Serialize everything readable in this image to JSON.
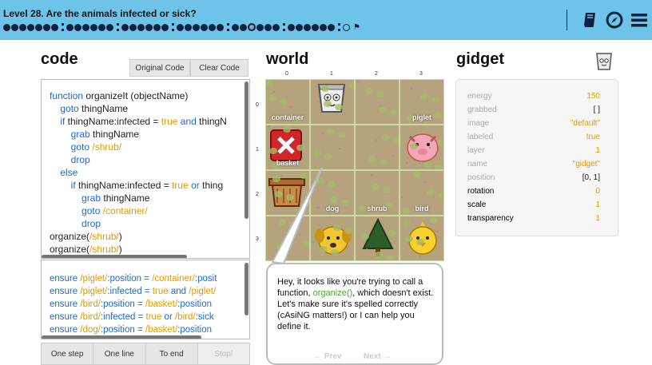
{
  "header": {
    "level_title": "Level 28. Are the animals infected or sick?",
    "progress_groups": [
      7,
      6,
      6,
      6,
      6,
      6,
      1
    ],
    "current_level_marker": "☺"
  },
  "icons": {
    "book": "book-icon",
    "compass": "compass-icon",
    "menu": "menu-icon"
  },
  "code": {
    "title": "code",
    "original_button": "Original Code",
    "clear_button": "Clear Code"
  },
  "ensure": {
    "lines": [
      {
        "a": "ensure ",
        "b": "/piglet/",
        "c": ":position = ",
        "d": "/container/",
        "e": ":posit"
      },
      {
        "a": "ensure ",
        "b": "/piglet/",
        "c": ":infected = ",
        "d": "true",
        "e": " and ",
        "f": "/piglet/"
      },
      {
        "a": "ensure ",
        "b": "/bird/",
        "c": ":position = ",
        "d": "/basket/",
        "e": ":position"
      },
      {
        "a": "ensure ",
        "b": "/bird/",
        "c": ":infected = ",
        "d": "true",
        "e": " or ",
        "f": "/bird/",
        "g": ":sick"
      },
      {
        "a": "ensure ",
        "b": "/dog/",
        "c": ":position = ",
        "d": "/basket/",
        "e": ":position"
      }
    ]
  },
  "controls": [
    "One step",
    "One line",
    "To end",
    "Stop!"
  ],
  "world": {
    "title": "world",
    "columns": [
      "0",
      "1",
      "2",
      "3"
    ],
    "rows": [
      "0",
      "1",
      "2",
      "3"
    ],
    "labels": {
      "container": "container",
      "piglet": "piglet",
      "basket": "basket",
      "dog": "dog",
      "shrub": "shrub",
      "bird": "bird"
    }
  },
  "bubble": {
    "text_before": "Hey, it looks like you're trying to call a function, ",
    "function_name": "organize()",
    "text_after": ", which doesn't exist. Let's make sure it's spelled correctly (cAsiNG matters!) or I can help you define it.",
    "prev": "← Prev",
    "next": "Next →"
  },
  "gidget": {
    "title": "gidget",
    "properties": [
      {
        "name": "energy",
        "value": "150",
        "dim": true
      },
      {
        "name": "grabbed",
        "value": "[ ]",
        "dim": true
      },
      {
        "name": "image",
        "value": "\"default\"",
        "dim": true
      },
      {
        "name": "labeled",
        "value": "true",
        "dim": true
      },
      {
        "name": "layer",
        "value": "1",
        "dim": true
      },
      {
        "name": "name",
        "value": "\"gidget\"",
        "dim": true
      },
      {
        "name": "position",
        "value": "[0, 1]",
        "dim": true
      },
      {
        "name": "rotation",
        "value": "0",
        "dim": false
      },
      {
        "name": "scale",
        "value": "1",
        "dim": false
      },
      {
        "name": "transparency",
        "value": "1",
        "dim": false
      }
    ]
  },
  "colors": {
    "keyword": "#1a6ad6",
    "string": "#e39a00",
    "function": "#4aa52a",
    "value": "#e39a00",
    "header": "#6ec4e8"
  }
}
